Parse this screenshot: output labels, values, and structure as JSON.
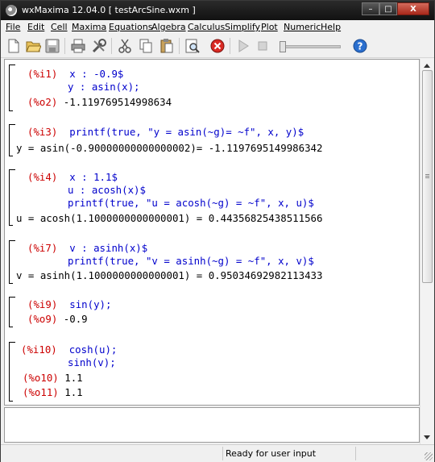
{
  "window": {
    "title": "wxMaxima 12.04.0  [ testArcSine.wxm ]",
    "buttons": {
      "minimize": "–",
      "maximize": "□",
      "close": "X"
    }
  },
  "menu": [
    "File",
    "Edit",
    "Cell",
    "Maxima",
    "Equations",
    "Algebra",
    "Calculus",
    "Simplify",
    "Plot",
    "Numeric",
    "Help"
  ],
  "toolbar": {
    "icons": [
      "new-icon",
      "open-icon",
      "save-icon",
      "print-icon",
      "config-icon",
      "cut-icon",
      "copy-icon",
      "paste-icon",
      "find-icon",
      "interrupt-icon",
      "play-icon",
      "stop-icon",
      "animation-slider",
      "help-icon"
    ],
    "colors": {
      "interrupt": "#d92a24",
      "help": "#2a6fcf"
    }
  },
  "cells": [
    {
      "lines": [
        {
          "label": "(%i1)",
          "text": "x : -0.9$",
          "kind": "input"
        },
        {
          "label": "",
          "text": "y : asin(x);",
          "kind": "input"
        },
        {
          "label": "(%o2)",
          "text": "-1.119769514998634",
          "kind": "output"
        }
      ]
    },
    {
      "lines": [
        {
          "label": "(%i3)",
          "text": "printf(true, \"y = asin(~g)= ~f\", x, y)$",
          "kind": "input"
        },
        {
          "label": "",
          "text": "y = asin(-0.90000000000000002)= -1.1197695149986342",
          "kind": "print"
        }
      ]
    },
    {
      "lines": [
        {
          "label": "(%i4)",
          "text": "x : 1.1$",
          "kind": "input"
        },
        {
          "label": "",
          "text": "u : acosh(x)$",
          "kind": "input"
        },
        {
          "label": "",
          "text": "printf(true, \"u = acosh(~g) = ~f\", x, u)$",
          "kind": "input"
        },
        {
          "label": "",
          "text": "u = acosh(1.1000000000000001) = 0.44356825438511566",
          "kind": "print"
        }
      ]
    },
    {
      "lines": [
        {
          "label": "(%i7)",
          "text": "v : asinh(x)$",
          "kind": "input"
        },
        {
          "label": "",
          "text": "printf(true, \"v = asinh(~g) = ~f\", x, v)$",
          "kind": "input"
        },
        {
          "label": "",
          "text": "v = asinh(1.1000000000000001) = 0.95034692982113433",
          "kind": "print"
        }
      ]
    },
    {
      "lines": [
        {
          "label": "(%i9)",
          "text": "sin(y);",
          "kind": "input"
        },
        {
          "label": "(%o9)",
          "text": "-0.9",
          "kind": "output"
        }
      ]
    },
    {
      "lines": [
        {
          "label": "(%i10)",
          "text": "cosh(u);",
          "kind": "input"
        },
        {
          "label": "",
          "text": "sinh(v);",
          "kind": "input"
        },
        {
          "label": "(%o10)",
          "text": "1.1",
          "kind": "output"
        },
        {
          "label": "(%o11)",
          "text": "1.1",
          "kind": "output"
        }
      ]
    }
  ],
  "status": {
    "message": "Ready for user input"
  }
}
